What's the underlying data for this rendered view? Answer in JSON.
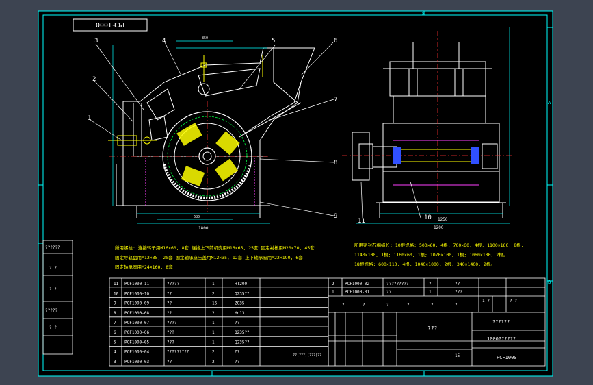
{
  "drawing": {
    "title_block_label": "PCF1000",
    "bg": "#000000",
    "line_cyan": "#00ffff",
    "line_white": "#ffffff",
    "line_yellow": "#ffff00",
    "line_red": "#ff3030",
    "line_magenta": "#ff40ff",
    "line_blue": "#3050ff",
    "line_green": "#00ff40"
  },
  "border_marks": {
    "top": "8",
    "right": "A",
    "right_b": "B",
    "bottom_center": "1"
  },
  "callouts": [
    "1",
    "2",
    "3",
    "4",
    "5",
    "6",
    "7",
    "8",
    "9",
    "10",
    "11"
  ],
  "dims": {
    "front_width": "1800",
    "front_sub": "680",
    "front_a": "850",
    "side_width": "1250",
    "side_b": "1200"
  },
  "notes": {
    "left_line1": "所用螺栓: 连接转子用M16×60, 8套  连接上下前机壳用M16×65, 25套  固定衬板用M20×70, 45套",
    "left_line2": "固定导轨盘用M12×35, 20套  固定轴承座压盖用M12×35, 12套   上下轴承座用M22×190, 6套",
    "left_line3": "固定轴承座用M24×160, 8套",
    "right_line1": "所用密封石棉绳长: 10根规格: 500×60, 4根; 700×60, 4根; 1100×160, 8根;",
    "right_line2": "1140×100, 1根; 1160×60, 1根; 1070×100, 1根; 1060×100, 2根。",
    "right_line3": "18根规格: 600×110, 4根; 1040×1000, 2根; 340×1400, 2根。"
  },
  "left_side_cells": [
    "??????",
    "?  ?",
    "?  ?",
    "?????",
    "?  ?"
  ],
  "bom": [
    {
      "no": "11",
      "code": "PCF1000-11",
      "name": "?????",
      "qty": "1",
      "mat": "HT200"
    },
    {
      "no": "10",
      "code": "PCF1000-10",
      "name": "??",
      "qty": "2",
      "mat": "Q235??"
    },
    {
      "no": "9",
      "code": "PCF1000-09",
      "name": "??",
      "qty": "16",
      "mat": "ZG35"
    },
    {
      "no": "8",
      "code": "PCF1000-08",
      "name": "??",
      "qty": "2",
      "mat": "Mn13"
    },
    {
      "no": "7",
      "code": "PCF1000-07",
      "name": "????",
      "qty": "1",
      "mat": "??"
    },
    {
      "no": "6",
      "code": "PCF1000-06",
      "name": "???",
      "qty": "1",
      "mat": "Q235??"
    },
    {
      "no": "5",
      "code": "PCF1000-05",
      "name": "???",
      "qty": "1",
      "mat": "Q235??"
    },
    {
      "no": "4",
      "code": "PCF1000-04",
      "name": "?????????",
      "qty": "2",
      "mat": "??"
    },
    {
      "no": "3",
      "code": "PCF1000-03",
      "name": "??",
      "qty": "2",
      "mat": "??"
    }
  ],
  "bom_right": [
    {
      "no": "2",
      "code": "PCF1000-02",
      "name": "?????????",
      "c4": "?",
      "c5": "??"
    },
    {
      "no": "1",
      "code": "PCF1000-01",
      "name": "??",
      "c4": "1",
      "c5": "???"
    }
  ],
  "header_row": {
    "a": "?",
    "b": "?",
    "c": "?",
    "d": "?",
    "e": "?",
    "f": "?"
  },
  "title_block": {
    "center_label": "???",
    "top_right": "??????",
    "mid_right": "1000??????",
    "bottom_right": "PCF1000",
    "small_a": "1 ?",
    "small_b": "? ?",
    "num_15": "15",
    "stamp": "??(???)(???)??"
  }
}
